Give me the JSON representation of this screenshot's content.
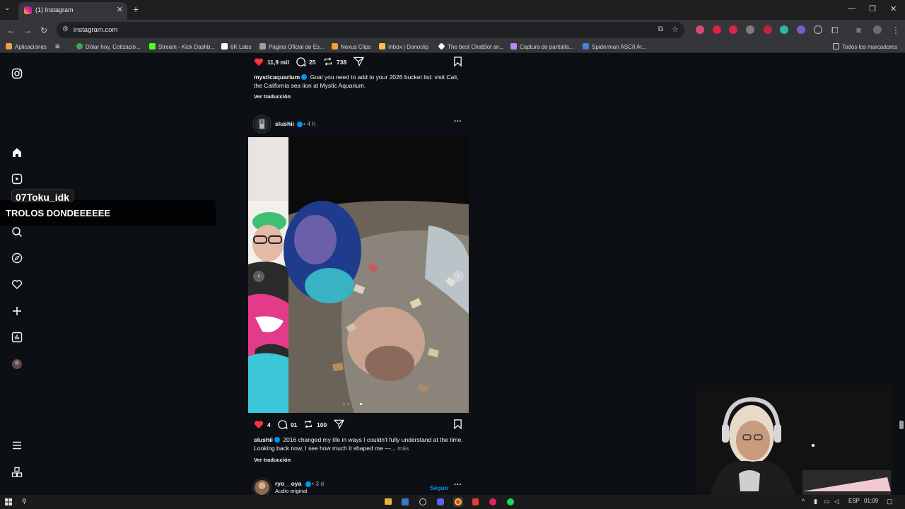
{
  "browser": {
    "tab_title": "(1) Instagram",
    "tab_close": "✕",
    "new_tab": "+",
    "url": "instagram.com",
    "window": {
      "minimize": "—",
      "restore": "❐",
      "close": "✕"
    },
    "bookmarks": [
      {
        "label": "Aplicaciones",
        "color": "#e8a33d"
      },
      {
        "label": "Dólar hoy, Cotizació...",
        "color": "#3aa857"
      },
      {
        "label": "Stream - Kick Dashb...",
        "color": "#53fc18"
      },
      {
        "label": "6K Labs",
        "color": "#ffffff"
      },
      {
        "label": "Página Oficial de Es...",
        "color": "#9aa0a6"
      },
      {
        "label": "Nexus Clips",
        "color": "#f2a134"
      },
      {
        "label": "Inbox | Donoclip",
        "color": "#f6c343"
      },
      {
        "label": "The best ChatBot an...",
        "color": "#ffffff"
      },
      {
        "label": "Captura de pantalla...",
        "color": "#b48cf2"
      },
      {
        "label": "Spiderman ASCII Ar...",
        "color": "#4a7fe0"
      }
    ],
    "all_bookmarks": "Todos los marcadores"
  },
  "feed": {
    "post1": {
      "likes": "11,9 mil",
      "comments": "25",
      "reposts": "738",
      "username": "mysticaquarium",
      "caption": "Goal you need to add to your 2026 bucket list: visit Cali, the California sea lion at Mystic Aquarium.",
      "translate": "Ver traducción"
    },
    "post2": {
      "username": "slushii",
      "time": "• 4 h",
      "more": "···",
      "likes": "4",
      "comments": "91",
      "reposts": "100",
      "caption": "2016 changed my life in ways I couldn't fully understand at the time. Looking back now, I see how much it shaped me —...",
      "more_link": "más",
      "translate": "Ver traducción"
    },
    "post3": {
      "username": "ryo__oya",
      "time": "• 3 d",
      "audio": "Audio original",
      "follow": "Seguir",
      "more": "···"
    }
  },
  "overlay": {
    "chat_user": "07Toku_idk",
    "chat_message": "TROLOS DONDEEEEEE"
  },
  "taskbar": {
    "lang": "ESP",
    "clock": "01:09"
  },
  "colors": {
    "like_red": "#ff3040",
    "verified_blue": "#0095f6",
    "follow_blue": "#0095f6"
  }
}
